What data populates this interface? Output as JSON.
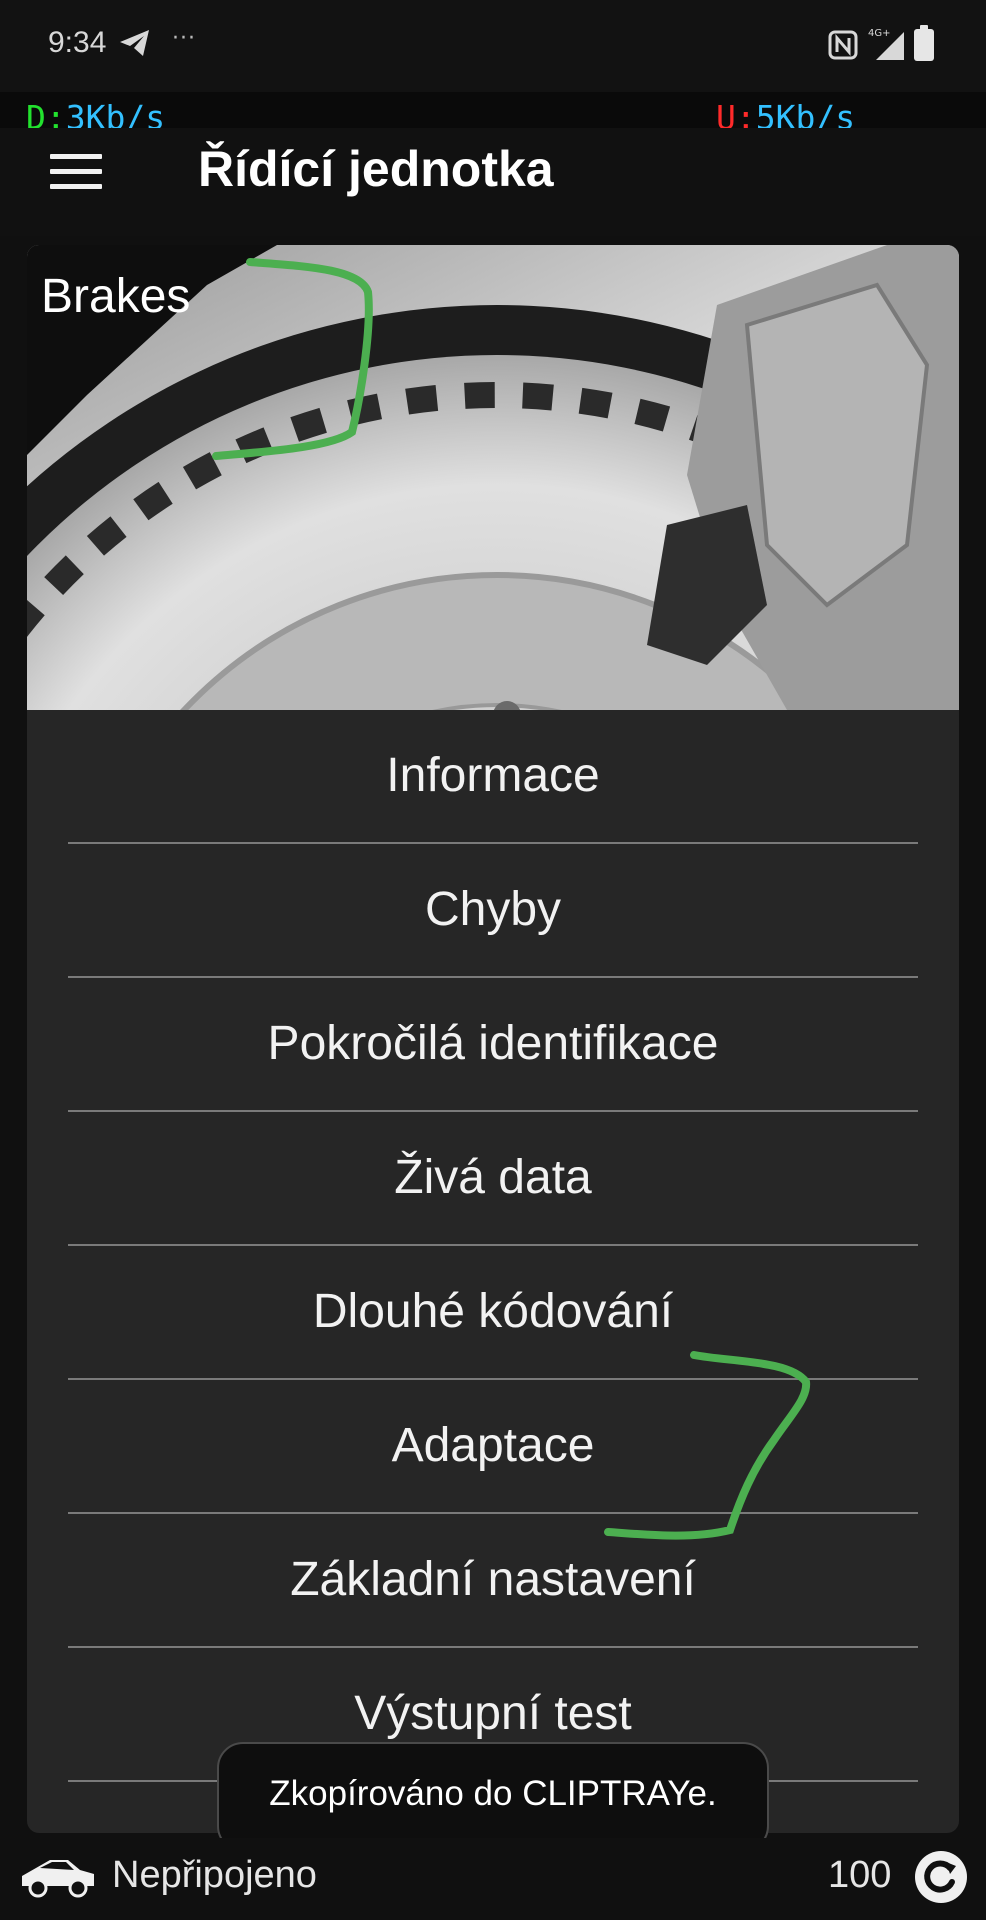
{
  "status_bar": {
    "time": "9:34",
    "more": "···",
    "network_label": "4G+"
  },
  "speed": {
    "down_label": "D:",
    "down_value": "3Kb/s",
    "up_label": "U:",
    "up_value": "5Kb/s"
  },
  "header": {
    "title": "Řídící jednotka"
  },
  "module": {
    "name": "Brakes"
  },
  "menu": {
    "items": [
      {
        "label": "Informace"
      },
      {
        "label": "Chyby"
      },
      {
        "label": "Pokročilá identifikace"
      },
      {
        "label": "Živá data"
      },
      {
        "label": "Dlouhé kódování"
      },
      {
        "label": "Adaptace"
      },
      {
        "label": "Základní nastavení"
      },
      {
        "label": "Výstupní test"
      }
    ]
  },
  "toast": {
    "message": "Zkopírováno do CLIPTRAYe."
  },
  "footer": {
    "connection_status": "Nepřipojeno",
    "count": "100"
  },
  "colors": {
    "download_label": "#22e22e",
    "upload_label": "#ff2a2a",
    "speed_value": "#33c0ff",
    "annotation_stroke": "#4caf50"
  },
  "icons": [
    "telegram-icon",
    "nfc-icon",
    "signal-icon",
    "battery-icon",
    "hamburger-icon",
    "car-icon",
    "refresh-icon"
  ]
}
